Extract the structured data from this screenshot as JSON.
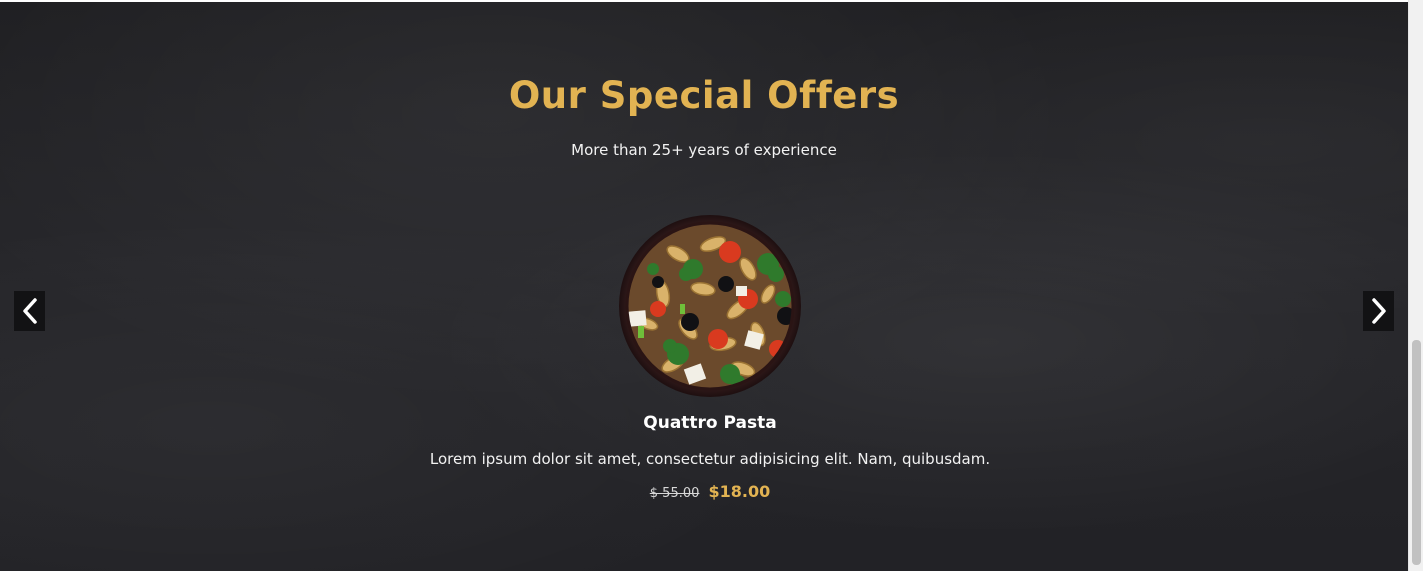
{
  "section": {
    "title": "Our Special Offers",
    "subtitle": "More than 25+ years of experience"
  },
  "offer": {
    "name": "Quattro Pasta",
    "description": "Lorem ipsum dolor sit amet, consectetur adipisicing elit. Nam, quibusdam.",
    "old_price": "$ 55.00",
    "new_price": "$18.00",
    "image": "pasta-salad-bowl"
  },
  "carousel": {
    "prev_icon": "chevron-left-icon",
    "next_icon": "chevron-right-icon"
  },
  "colors": {
    "accent": "#e2b352",
    "background": "#242428",
    "text": "#ffffff"
  }
}
